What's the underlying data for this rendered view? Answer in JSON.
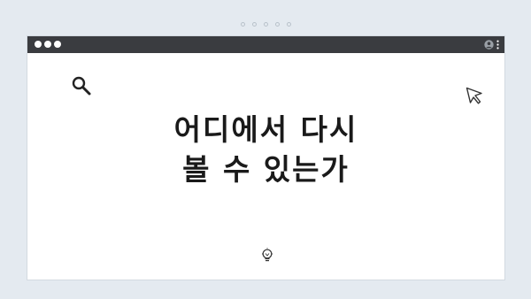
{
  "page": {
    "background_color": "#e4eaf0",
    "window_background": "#ffffff",
    "titlebar_color": "#3a3c40"
  },
  "top_indicator": {
    "dots": [
      "dot",
      "dot",
      "dot",
      "dot",
      "dot"
    ]
  },
  "titlebar": {
    "window_buttons": [
      "window-button",
      "window-button",
      "window-button"
    ],
    "icons": [
      "user-icon",
      "more-vertical-icon"
    ]
  },
  "content": {
    "heading_line1": "어디에서 다시",
    "heading_line2": "볼 수 있는가",
    "icons": [
      "search-icon",
      "cursor-arrow-icon",
      "lightbulb-icon"
    ]
  }
}
